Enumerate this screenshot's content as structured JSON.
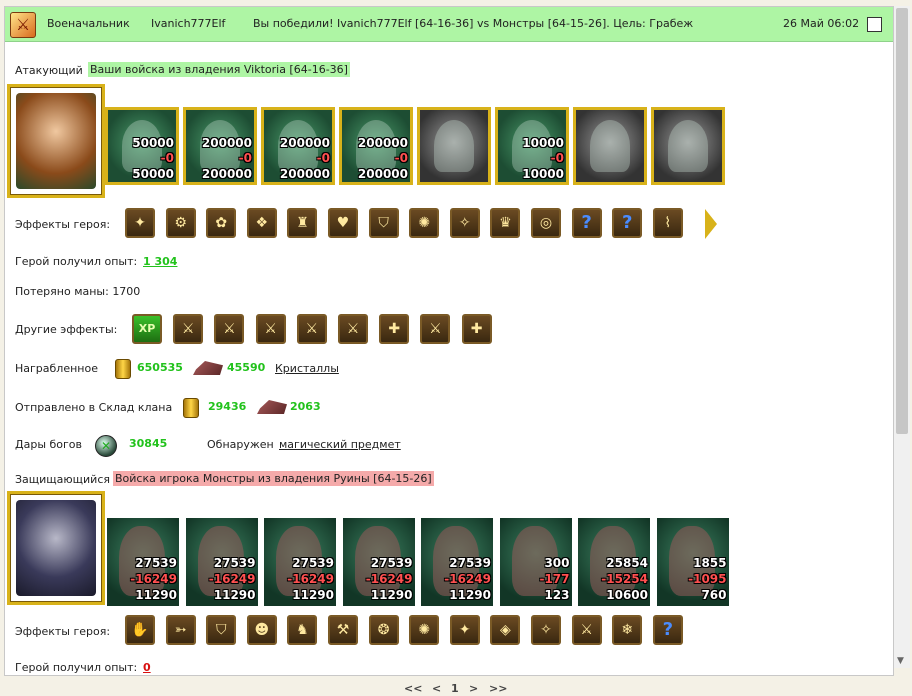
{
  "topbar": {
    "commander_label": "Военачальник",
    "player_name": "Ivanich777Elf",
    "result_text": "Вы победили! Ivanich777Elf [64-16-36] vs Монстры [64-15-26]. Цель: Грабеж",
    "datetime": "26 Май 06:02"
  },
  "attacker": {
    "label": "Атакующий",
    "army_text": "Ваши войска из владения Viktoria [64-16-36]",
    "units": [
      {
        "count": "50000",
        "loss": "-0",
        "remaining": "50000",
        "icon": "dwarf-warrior-icon"
      },
      {
        "count": "200000",
        "loss": "-0",
        "remaining": "200000",
        "icon": "elf-swordsman-icon"
      },
      {
        "count": "200000",
        "loss": "-0",
        "remaining": "200000",
        "icon": "elf-archer-icon"
      },
      {
        "count": "200000",
        "loss": "-0",
        "remaining": "200000",
        "icon": "winged-elf-icon"
      },
      {
        "count": "",
        "loss": "",
        "remaining": "",
        "icon": "gray-archer-icon"
      },
      {
        "count": "10000",
        "loss": "-0",
        "remaining": "10000",
        "icon": "elf-mage-icon"
      },
      {
        "count": "",
        "loss": "",
        "remaining": "",
        "icon": "gray-knight-icon"
      },
      {
        "count": "",
        "loss": "",
        "remaining": "",
        "icon": "gray-monk-icon"
      }
    ],
    "hero_effects_label": "Эффекты героя:",
    "hero_effects": [
      "✦",
      "⚙",
      "✿",
      "❖",
      "♜",
      "♥",
      "⛉",
      "✺",
      "✧",
      "♛",
      "◎",
      "?",
      "?",
      "⌇"
    ],
    "exp_label": "Герой получил опыт:",
    "exp_value": "1 304",
    "mana_text": "Потеряно маны: 1700",
    "other_effects_label": "Другие эффекты:",
    "other_effects": [
      "XP",
      "⚔",
      "⚔",
      "⚔",
      "⚔",
      "⚔",
      "✚",
      "⚔",
      "✚"
    ],
    "loot_label": "Награбленное",
    "loot_gold": "650535",
    "loot_ore": "45590",
    "loot_link": "Кристаллы",
    "clan_label": "Отправлено в Склад клана",
    "clan_gold": "29436",
    "clan_ore": "2063",
    "gifts_label": "Дары богов",
    "gifts_value": "30845",
    "found_label": "Обнаружен",
    "found_link": "магический предмет"
  },
  "defender": {
    "label": "Защищающийся",
    "army_text": "Войска игрока Монстры из владения Руины [64-15-26]",
    "units": [
      {
        "count": "27539",
        "loss": "-16249",
        "remaining": "11290"
      },
      {
        "count": "27539",
        "loss": "-16249",
        "remaining": "11290"
      },
      {
        "count": "27539",
        "loss": "-16249",
        "remaining": "11290"
      },
      {
        "count": "27539",
        "loss": "-16249",
        "remaining": "11290"
      },
      {
        "count": "27539",
        "loss": "-16249",
        "remaining": "11290"
      },
      {
        "count": "300",
        "loss": "-177",
        "remaining": "123"
      },
      {
        "count": "25854",
        "loss": "-15254",
        "remaining": "10600"
      },
      {
        "count": "1855",
        "loss": "-1095",
        "remaining": "760"
      }
    ],
    "hero_effects_label": "Эффекты героя:",
    "hero_effects": [
      "✋",
      "➳",
      "⛉",
      "☻",
      "♞",
      "⚒",
      "❂",
      "✺",
      "✦",
      "◈",
      "✧",
      "⚔",
      "❄",
      "?"
    ],
    "exp_label": "Герой получил опыт:",
    "exp_value": "0"
  },
  "pager": {
    "first": "<<",
    "prev": "<",
    "current": "1",
    "next": ">",
    "last": ">>"
  }
}
